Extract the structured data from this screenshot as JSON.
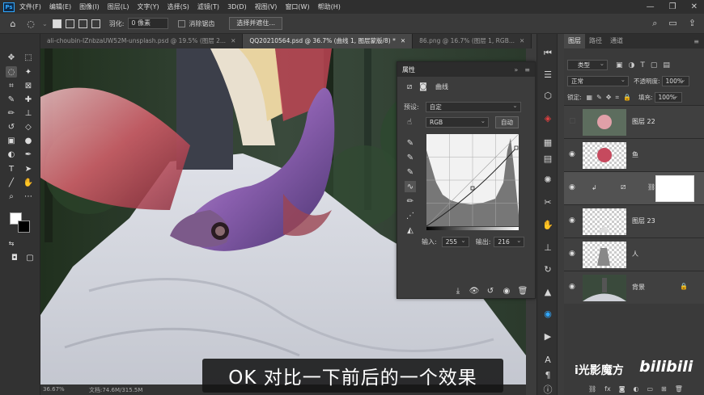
{
  "menubar": {
    "items": [
      "文件(F)",
      "编辑(E)",
      "图像(I)",
      "图层(L)",
      "文字(Y)",
      "选择(S)",
      "滤镜(T)",
      "3D(D)",
      "视图(V)",
      "窗口(W)",
      "帮助(H)"
    ],
    "logo": "Ps"
  },
  "options": {
    "feather_label": "羽化:",
    "feather_value": "0 像素",
    "antialias_label": "消除锯齿",
    "select_subject": "选择并遮住..."
  },
  "tabs": [
    {
      "label": "ali-choubin-IZnbzaUW52M-unsplash.psd @ 19.5% (图层 2...",
      "active": false
    },
    {
      "label": "QQ20210564.psd @ 36.7% (曲线 1, 图层蒙版/8) *",
      "active": true
    },
    {
      "label": "86.png @ 16.7% (图层 1, RGB...",
      "active": false
    }
  ],
  "status": {
    "zoom": "36.67%",
    "doc": "文档:74.6M/315.5M"
  },
  "properties": {
    "title": "属性",
    "type_label": "曲线",
    "preset_label": "预设:",
    "preset_value": "自定",
    "channel": "RGB",
    "auto_button": "自动",
    "input_label": "输入:",
    "input_value": "255",
    "output_label": "输出:",
    "output_value": "216"
  },
  "layers_panel": {
    "tabs": [
      "图层",
      "路径",
      "通道"
    ],
    "kind_filter": "类型",
    "blend_mode": "正常",
    "opacity_label": "不透明度:",
    "opacity_value": "100%",
    "lock_label": "锁定:",
    "fill_label": "填充:",
    "fill_value": "100%",
    "layers": [
      {
        "name": "图层 22",
        "visible": false,
        "selected": false
      },
      {
        "name": "鱼",
        "visible": true,
        "selected": false
      },
      {
        "name": "",
        "visible": true,
        "selected": true
      },
      {
        "name": "图层 23",
        "visible": true,
        "selected": false
      },
      {
        "name": "人",
        "visible": true,
        "selected": false
      },
      {
        "name": "背景",
        "visible": true,
        "selected": false
      }
    ]
  },
  "subtitle": "OK 对比一下前后的一个效果",
  "watermark": "i光影魔方",
  "bilibili": "bilibili"
}
